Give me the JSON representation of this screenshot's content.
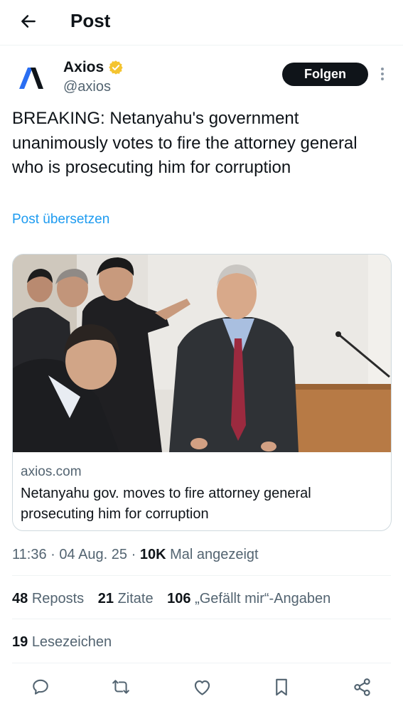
{
  "header": {
    "title": "Post",
    "back_icon": "arrow-left-icon"
  },
  "author": {
    "name": "Axios",
    "handle": "@axios",
    "verified_icon": "verified-badge-icon",
    "verified_color": "#f4c430",
    "follow_label": "Folgen",
    "more_icon": "more-vertical-icon"
  },
  "post": {
    "text": "BREAKING: Netanyahu's government unanimously votes to fire the attorney general who is prosecuting him for corruption",
    "translate_label": "Post übersetzen"
  },
  "card": {
    "domain": "axios.com",
    "title": "Netanyahu gov. moves to fire attorney general prosecuting him for corruption"
  },
  "meta": {
    "time": "11:36",
    "sep": "·",
    "date": "04 Aug. 25",
    "views_count": "10K",
    "views_label": "Mal angezeigt"
  },
  "stats": {
    "reposts_count": "48",
    "reposts_label": "Reposts",
    "quotes_count": "21",
    "quotes_label": "Zitate",
    "likes_count": "106",
    "likes_label": "„Gefällt mir“-Angaben",
    "bookmarks_count": "19",
    "bookmarks_label": "Lesezeichen"
  },
  "actions": [
    "reply-icon",
    "repost-icon",
    "like-icon",
    "bookmark-icon",
    "share-icon"
  ],
  "colors": {
    "accent": "#1d9bf0",
    "text": "#0f1419",
    "secondary": "#536471",
    "logo_blue": "#2a6ef2"
  }
}
